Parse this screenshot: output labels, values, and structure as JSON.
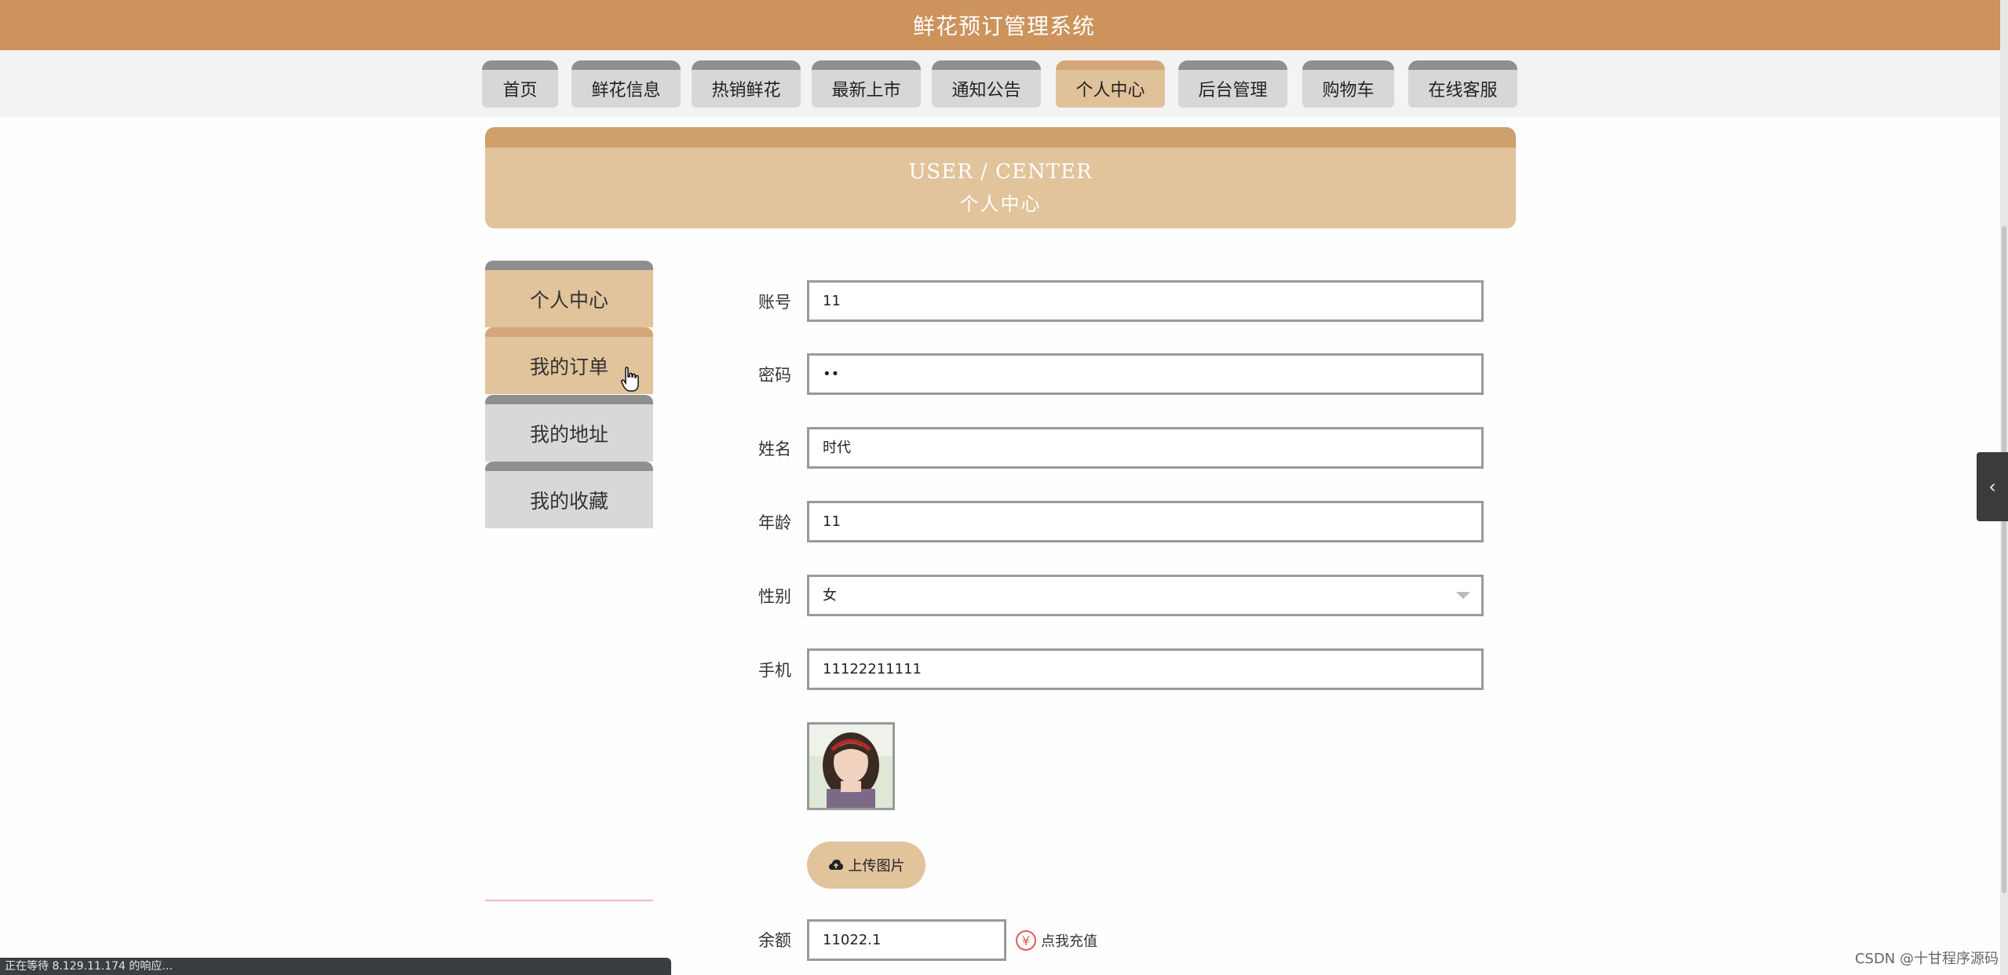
{
  "header": {
    "title": "鲜花预订管理系统"
  },
  "nav": {
    "items": [
      {
        "label": "首页"
      },
      {
        "label": "鲜花信息"
      },
      {
        "label": "热销鲜花"
      },
      {
        "label": "最新上市"
      },
      {
        "label": "通知公告"
      },
      {
        "label": "个人中心"
      },
      {
        "label": "后台管理"
      },
      {
        "label": "购物车"
      },
      {
        "label": "在线客服"
      }
    ],
    "active": "个人中心"
  },
  "banner": {
    "en": "USER / CENTER",
    "cn": "个人中心"
  },
  "sidebar": {
    "items": [
      {
        "label": "个人中心"
      },
      {
        "label": "我的订单"
      },
      {
        "label": "我的地址"
      },
      {
        "label": "我的收藏"
      }
    ]
  },
  "form": {
    "account": {
      "label": "账号",
      "value": "11"
    },
    "password": {
      "label": "密码",
      "value": "••"
    },
    "name": {
      "label": "姓名",
      "value": "时代"
    },
    "age": {
      "label": "年龄",
      "value": "11"
    },
    "gender": {
      "label": "性别",
      "value": "女"
    },
    "phone": {
      "label": "手机",
      "value": "11122211111"
    },
    "upload_label": "上传图片",
    "balance": {
      "label": "余额",
      "value": "11022.1"
    },
    "recharge_label": "点我充值"
  },
  "status_bar": {
    "text": "正在等待 8.129.11.174 的响应..."
  },
  "watermark": "CSDN @十甘程序源码",
  "colors": {
    "header": "#cc935c",
    "accent": "#e1c39c",
    "tab_top": "#8f8f8f"
  },
  "icons": {
    "upload": "cloud-upload-icon",
    "recharge": "yen-icon",
    "toggle": "chevron-left-icon",
    "cursor": "hand-pointer-icon"
  }
}
